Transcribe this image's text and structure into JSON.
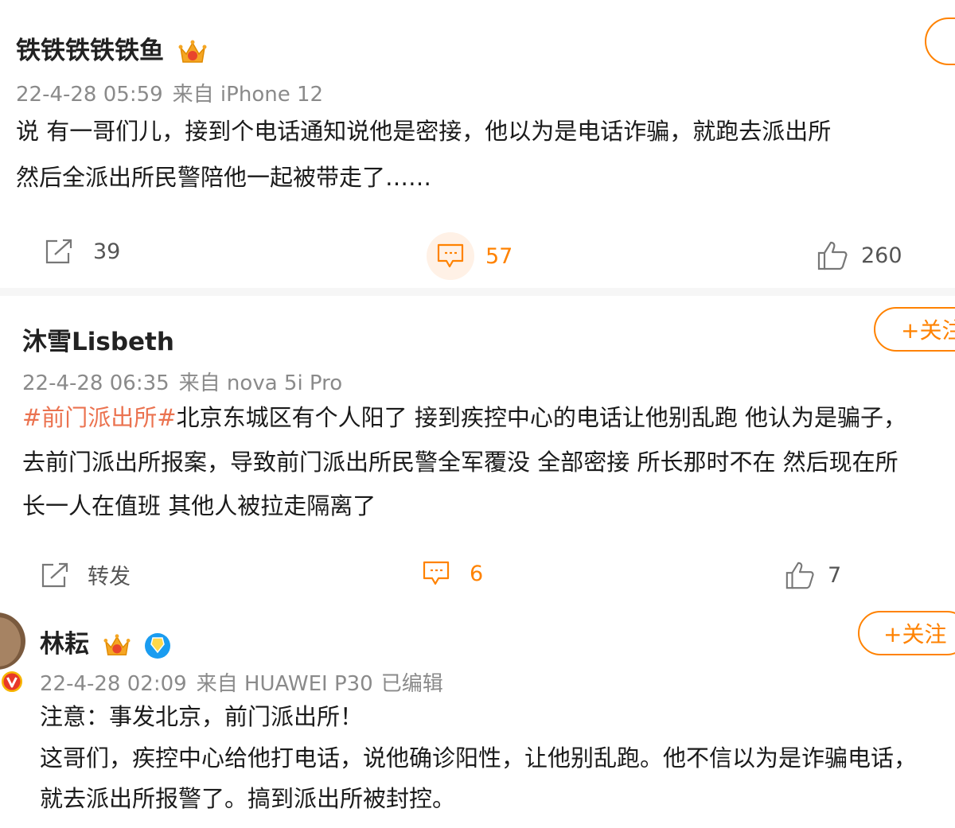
{
  "posts": [
    {
      "username": "铁铁铁铁铁鱼",
      "date": "22-4-28 05:59",
      "source": "来自 iPhone 12",
      "lines": [
        "说 有一哥们儿，接到个电话通知说他是密接，他以为是电话诈骗，就跑去派出所",
        "然后全派出所民警陪他一起被带走了……"
      ],
      "repost": "39",
      "comments": "57",
      "likes": "260"
    },
    {
      "username": "沐雪Lisbeth",
      "date": "22-4-28 06:35",
      "source": "来自 nova 5i Pro",
      "follow_label": "+关注",
      "topic": "#前门派出所#",
      "line1_rest": "北京东城区有个人阳了 接到疾控中心的电话让他别乱跑 他认为是骗子，",
      "line2": "去前门派出所报案，导致前门派出所民警全军覆没 全部密接 所长那时不在 然后现在所",
      "line3": "长一人在值班 其他人被拉走隔离了",
      "repost": "转发",
      "comments": "6",
      "likes": "7"
    },
    {
      "username": "林耘",
      "date": "22-4-28 02:09",
      "source": "来自 HUAWEI P30",
      "edited": "已编辑",
      "follow_label": "+关注",
      "lines": [
        "注意：事发北京，前门派出所！",
        "这哥们，疾控中心给他打电话，说他确诊阳性，让他别乱跑。他不信以为是诈骗电话，",
        "就去派出所报警了。搞到派出所被封控。"
      ]
    }
  ],
  "colors": {
    "accent": "#ff8200",
    "topic": "#eb7350",
    "meta": "#8a8a8a"
  },
  "icons": [
    "crown-icon",
    "repost-icon",
    "comment-icon",
    "like-icon",
    "verified-icon",
    "v-badge-icon"
  ]
}
